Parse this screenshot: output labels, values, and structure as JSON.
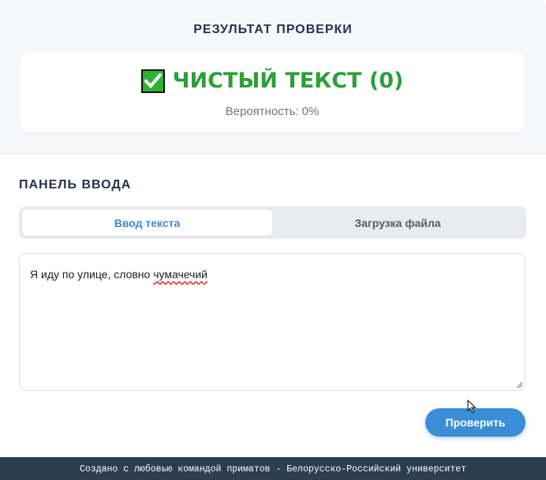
{
  "result": {
    "title": "РЕЗУЛЬТАТ ПРОВЕРКИ",
    "verdict": "ЧИСТЫЙ ТЕКСТ (0)",
    "probability_label": "Вероятность:",
    "probability_value": "0%",
    "icon": "check-mark-icon",
    "verdict_color": "#2e9e3a"
  },
  "input_panel": {
    "title": "ПАНЕЛЬ ВВОДА",
    "tabs": [
      {
        "label": "Ввод текста",
        "active": true
      },
      {
        "label": "Загрузка файла",
        "active": false
      }
    ],
    "text_before": "Я иду по улице, словно ",
    "text_misspelled": "чумачечий",
    "submit_label": "Проверить",
    "accent_color": "#3a8ed8"
  },
  "footer": {
    "text": "Создано с любовью командой приматов - Белорусско-Российский университет"
  }
}
